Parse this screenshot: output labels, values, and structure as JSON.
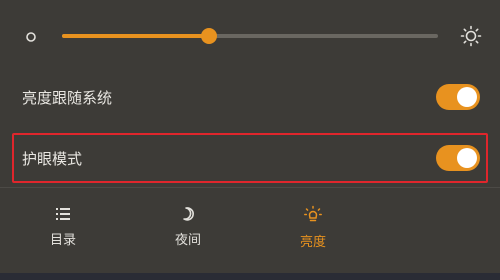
{
  "brightness": {
    "level": 0.39,
    "min_icon": "brightness-low-icon",
    "max_icon": "brightness-high-icon"
  },
  "settings": {
    "follow_system": {
      "label": "亮度跟随系统",
      "on": true
    },
    "eye_care": {
      "label": "护眼模式",
      "on": true
    }
  },
  "tabs": [
    {
      "label": "目录",
      "icon": "list-icon",
      "active": false
    },
    {
      "label": "夜间",
      "icon": "moon-icon",
      "active": false
    },
    {
      "label": "亮度",
      "icon": "light-bulb-icon",
      "active": true
    }
  ],
  "colors": {
    "accent": "#e8921f",
    "background": "#3d3b37",
    "highlight_border": "#e0262c"
  }
}
